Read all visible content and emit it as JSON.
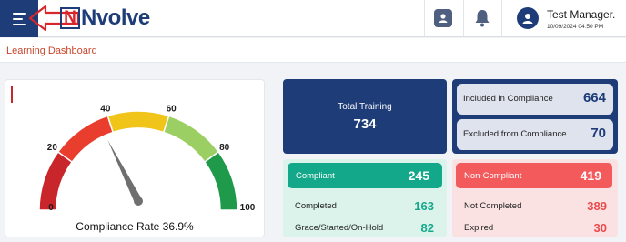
{
  "header": {
    "brand": {
      "mark": "N",
      "text": "Nvolve"
    },
    "icons": [
      "menu-icon",
      "profile-card-icon",
      "notification-bell-icon",
      "user-avatar-icon"
    ],
    "user": {
      "name": "Test Manager.",
      "timestamp": "10/09/2024 04:50 PM"
    }
  },
  "page": {
    "title": "Learning Dashboard"
  },
  "gauge": {
    "caption": "Compliance Rate 36.9%",
    "value": 36.9,
    "ticks": [
      "0",
      "20",
      "40",
      "60",
      "80",
      "100"
    ],
    "segment_colors": [
      "#c9262b",
      "#e93d2e",
      "#f0c419",
      "#9ccf63",
      "#1e9a4a"
    ],
    "needle_color": "#6f6f6f"
  },
  "tiles": {
    "total": {
      "label": "Total Training",
      "value": "734"
    },
    "included": {
      "label": "Included in Compliance",
      "value": "664"
    },
    "excluded": {
      "label": "Excluded from Compliance",
      "value": "70"
    },
    "compliant": {
      "label": "Compliant",
      "value": "245",
      "rows": [
        {
          "label": "Completed",
          "value": "163"
        },
        {
          "label": "Grace/Started/On-Hold",
          "value": "82"
        }
      ]
    },
    "non_compliant": {
      "label": "Non-Compliant",
      "value": "419",
      "rows": [
        {
          "label": "Not Completed",
          "value": "389"
        },
        {
          "label": "Expired",
          "value": "30"
        }
      ]
    }
  },
  "colors": {
    "brand_navy": "#1d3c78",
    "accent_red": "#c8462b",
    "compliant_green": "#14a88a",
    "noncompliant_red": "#f25a5c"
  }
}
